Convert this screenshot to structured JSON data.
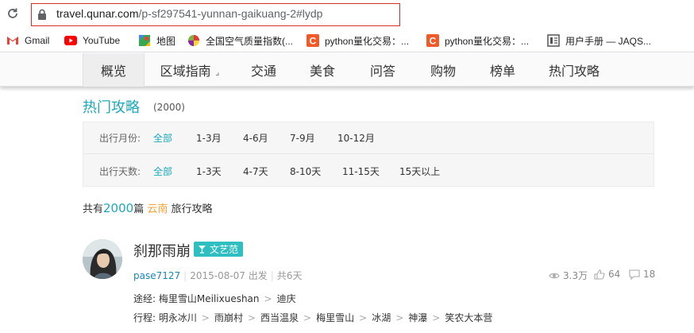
{
  "browser": {
    "url_host": "travel.qunar.com",
    "url_path": "/p-sf297541-yunnan-gaikuang-2#lydp",
    "bookmarks": [
      {
        "label": "Gmail",
        "icon": "gmail-icon"
      },
      {
        "label": "YouTube",
        "icon": "youtube-icon"
      },
      {
        "label": "地图",
        "icon": "maps-icon"
      },
      {
        "label": "全国空气质量指数(...",
        "icon": "aqi-icon"
      },
      {
        "label": "python量化交易：...",
        "icon": "quant-icon"
      },
      {
        "label": "python量化交易：...",
        "icon": "quant-icon"
      },
      {
        "label": "用户手册 — JAQS...",
        "icon": "doc-icon"
      }
    ]
  },
  "nav": {
    "items": [
      {
        "label": "概览"
      },
      {
        "label": "区域指南"
      },
      {
        "label": "交通"
      },
      {
        "label": "美食"
      },
      {
        "label": "问答"
      },
      {
        "label": "购物"
      },
      {
        "label": "榜单"
      },
      {
        "label": "热门攻略"
      }
    ],
    "active": "概览"
  },
  "section": {
    "title": "热门攻略",
    "count": "(2000)"
  },
  "filters": {
    "month": {
      "label": "出行月份:",
      "options": [
        "全部",
        "1-3月",
        "4-6月",
        "7-9月",
        "10-12月"
      ]
    },
    "days": {
      "label": "出行天数:",
      "options": [
        "全部",
        "1-3天",
        "4-7天",
        "8-10天",
        "11-15天",
        "15天以上"
      ]
    }
  },
  "summary": {
    "prefix": "共有",
    "count": "2000",
    "middle": "篇",
    "place": "云南",
    "suffix": "旅行攻略"
  },
  "post": {
    "author": "刹那雨崩",
    "badge": "文艺范",
    "username": "pase7127",
    "date": "2015-08-07 出发",
    "duration": "共6天",
    "views": "3.3万",
    "likes": "64",
    "comments": "18",
    "route_label": "途经:",
    "route": [
      "梅里雪山Meilixueshan",
      "迪庆"
    ],
    "itinerary_label": "行程:",
    "itinerary": [
      "明永冰川",
      "雨崩村",
      "西当温泉",
      "梅里雪山",
      "冰湖",
      "神瀑",
      "笑农大本营"
    ]
  },
  "colors": {
    "accent": "#1ba9ba",
    "badge": "#30bfc1",
    "place": "#f4a239",
    "url_border": "#d93025"
  }
}
